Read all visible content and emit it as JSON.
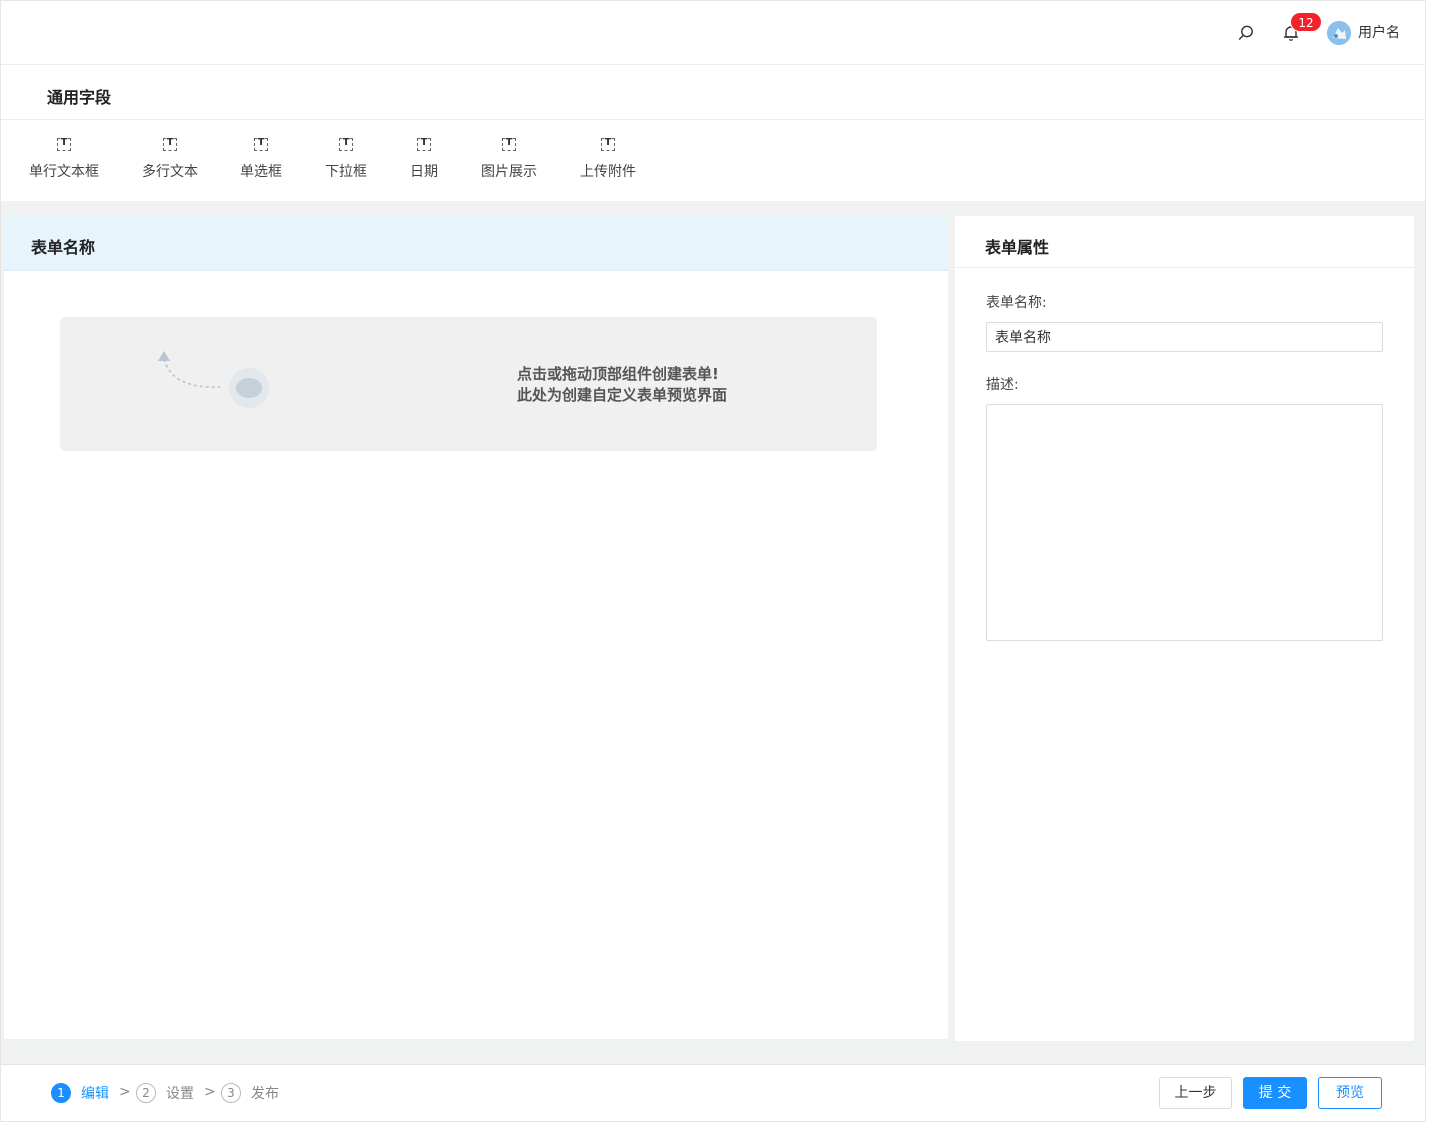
{
  "header": {
    "notification_count": "12",
    "username": "用户名"
  },
  "fields": {
    "title": "通用字段",
    "items": [
      {
        "label": "单行文本框"
      },
      {
        "label": "多行文本"
      },
      {
        "label": "单选框"
      },
      {
        "label": "下拉框"
      },
      {
        "label": "日期"
      },
      {
        "label": "图片展示"
      },
      {
        "label": "上传附件"
      }
    ]
  },
  "canvas": {
    "title": "表单名称",
    "empty_line1": "点击或拖动顶部组件创建表单!",
    "empty_line2": "此处为创建自定义表单预览界面"
  },
  "props": {
    "title": "表单属性",
    "name_label": "表单名称:",
    "name_value": "表单名称",
    "desc_label": "描述:",
    "desc_value": ""
  },
  "steps": [
    {
      "num": "1",
      "label": "编辑",
      "active": true
    },
    {
      "num": "2",
      "label": "设置",
      "active": false
    },
    {
      "num": "3",
      "label": "发布",
      "active": false
    }
  ],
  "step_separator": ">",
  "actions": {
    "prev": "上一步",
    "submit": "提 交",
    "preview": "预览"
  },
  "colors": {
    "primary": "#1890ff",
    "badge": "#f5222d",
    "canvas_header_bg": "#e6f4fc",
    "workspace_bg": "#f0f2f2"
  }
}
